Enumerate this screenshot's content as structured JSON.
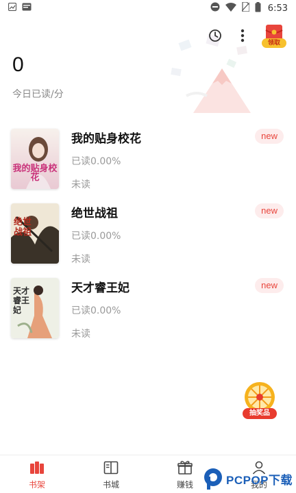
{
  "status_bar": {
    "time": "6:53"
  },
  "header": {
    "redpack_label": "领取"
  },
  "reading": {
    "minutes": "0",
    "caption": "今日已读/分"
  },
  "books": [
    {
      "title": "我的贴身校花",
      "progress": "已读0.00%",
      "status": "未读",
      "badge": "new",
      "cover_text": "我的贴身校花"
    },
    {
      "title": "绝世战祖",
      "progress": "已读0.00%",
      "status": "未读",
      "badge": "new",
      "cover_text": "绝世战祖"
    },
    {
      "title": "天才睿王妃",
      "progress": "已读0.00%",
      "status": "未读",
      "badge": "new",
      "cover_text": "天才睿王妃"
    }
  ],
  "prize": {
    "label": "抽奖品"
  },
  "bottom_nav": [
    {
      "label": "书架",
      "active": true
    },
    {
      "label": "书城"
    },
    {
      "label": "赚钱"
    },
    {
      "label": "我的"
    }
  ],
  "watermark": {
    "brand": "PCPOP",
    "suffix": "下载"
  },
  "colors": {
    "accent": "#e8453c",
    "badge_bg": "#fdecec"
  }
}
